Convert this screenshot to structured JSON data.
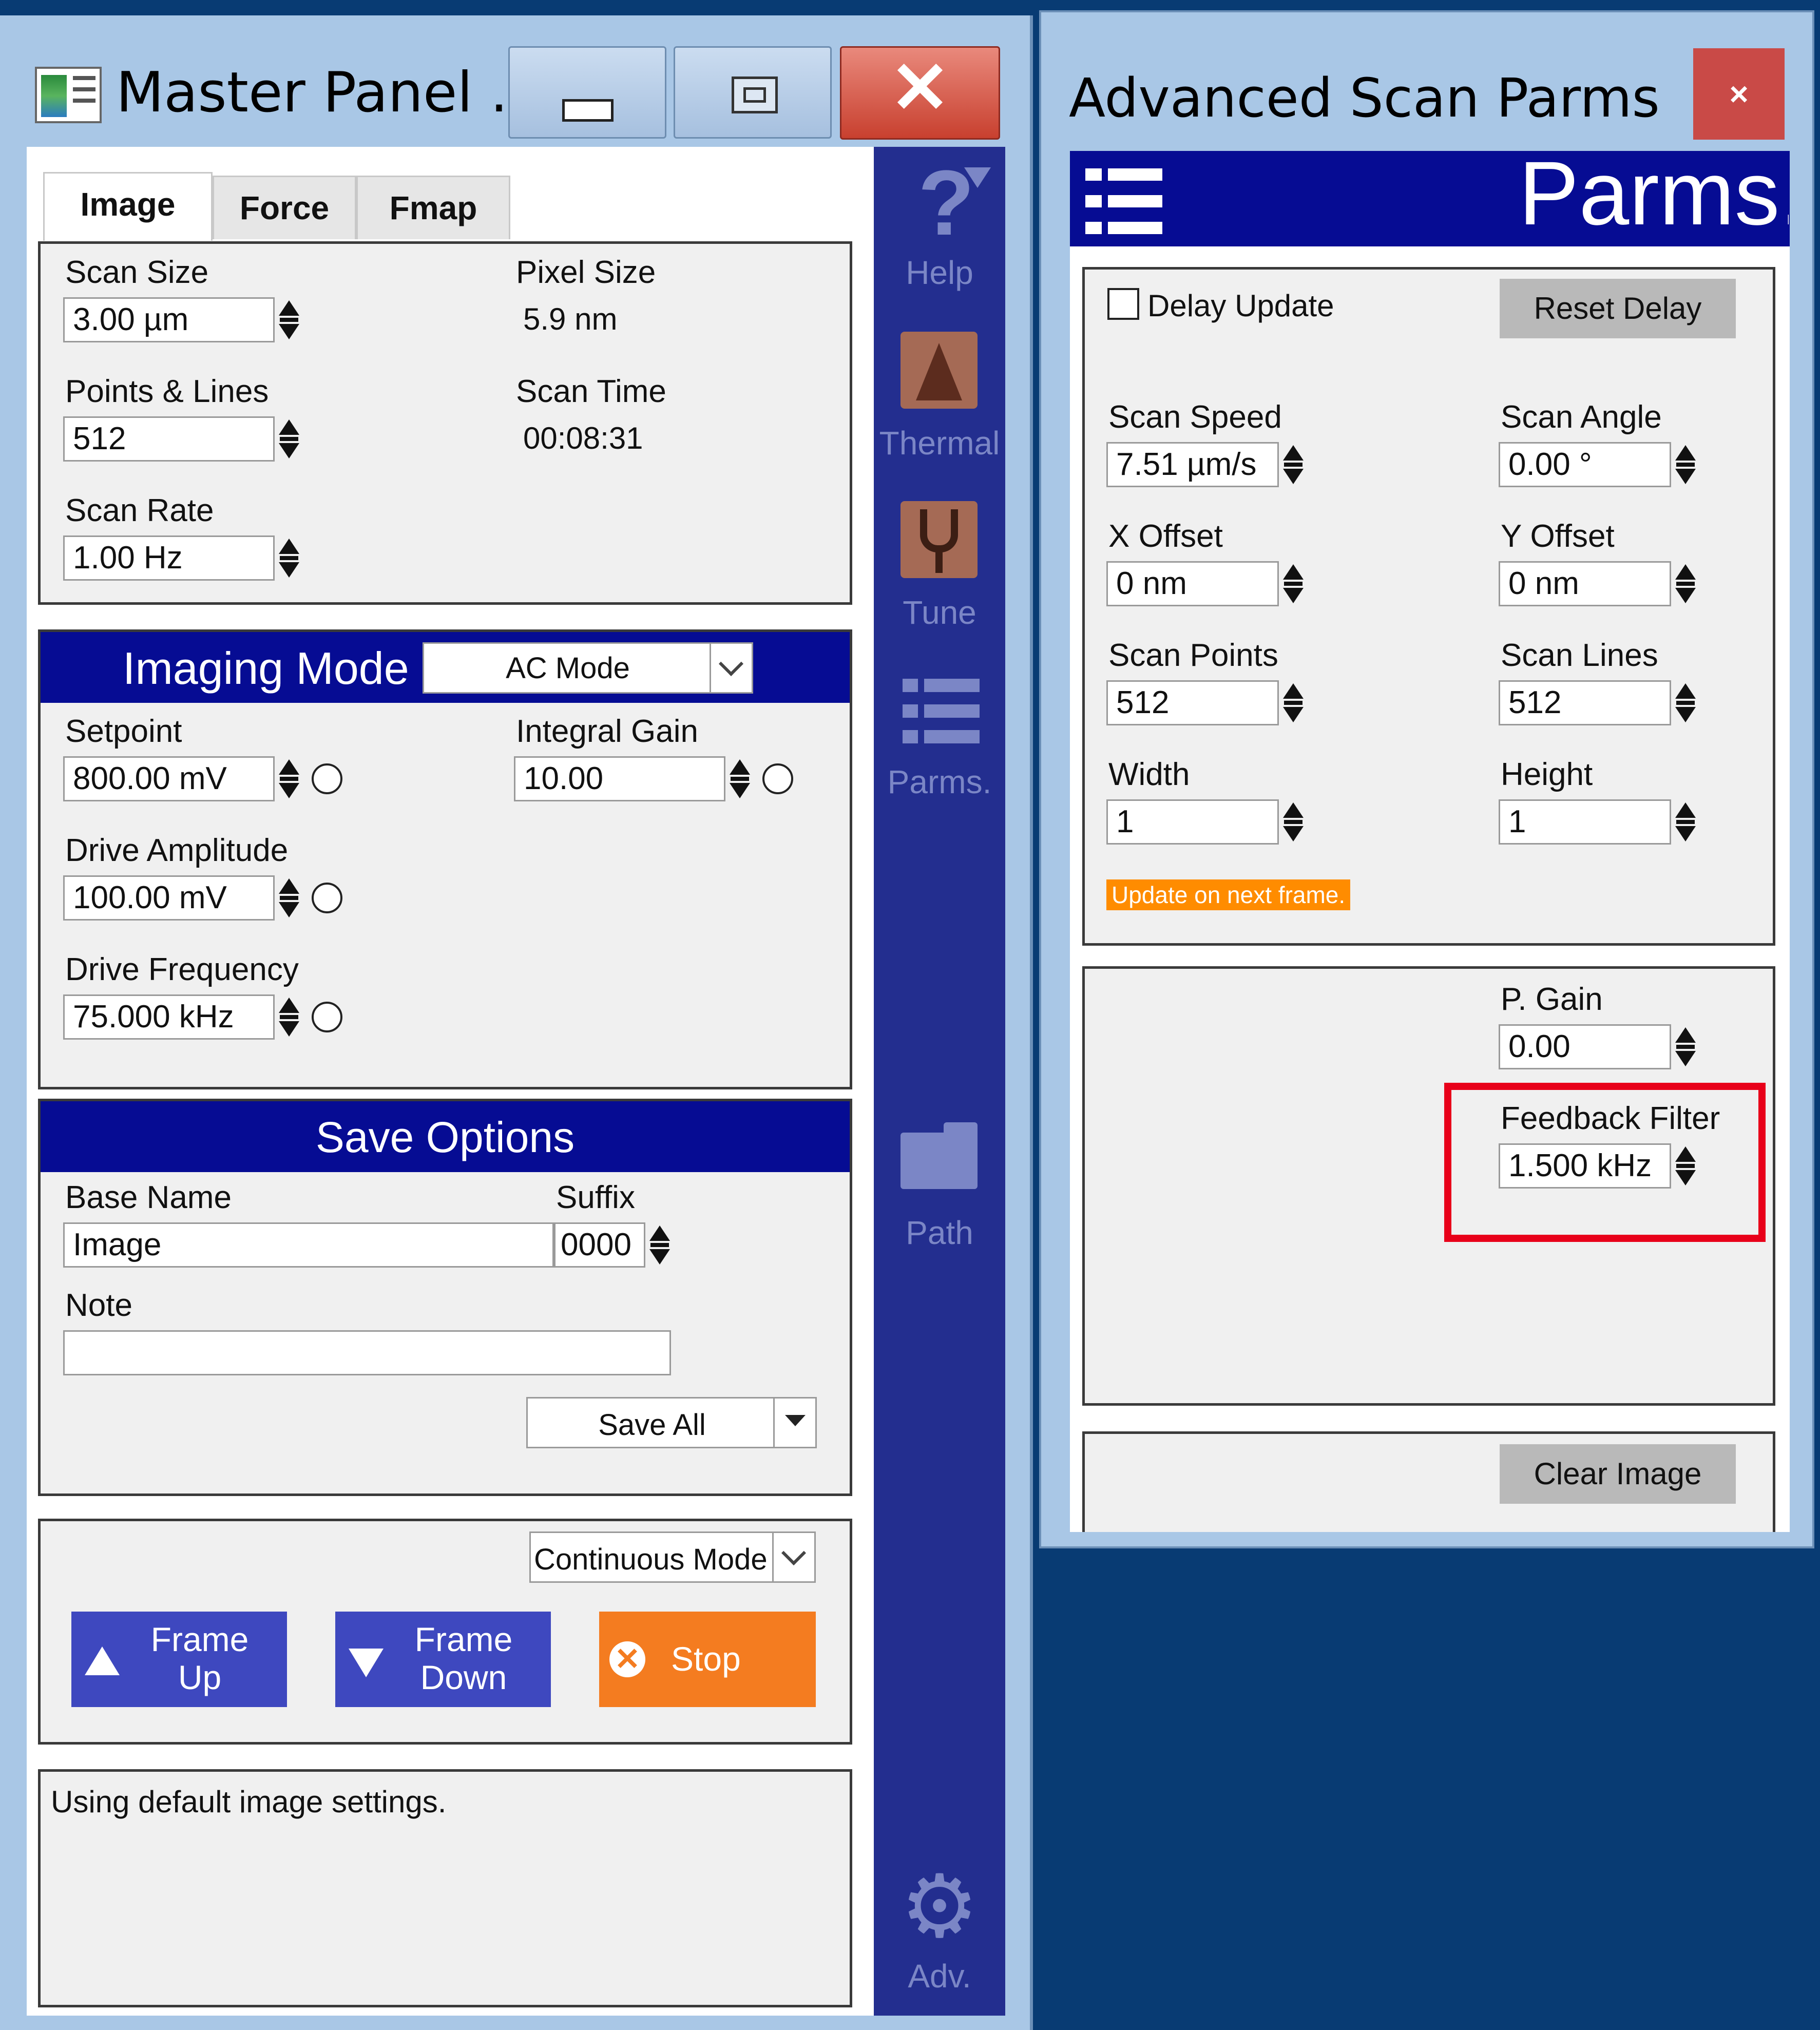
{
  "master_panel": {
    "title": "Master Panel ...",
    "tabs": [
      "Image",
      "Force",
      "Fmap"
    ],
    "scan": {
      "scan_size_label": "Scan Size",
      "scan_size_value": "3.00 µm",
      "pixel_size_label": "Pixel Size",
      "pixel_size_value": "5.9 nm",
      "points_lines_label": "Points & Lines",
      "points_lines_value": "512",
      "scan_time_label": "Scan Time",
      "scan_time_value": "00:08:31",
      "scan_rate_label": "Scan Rate",
      "scan_rate_value": "1.00 Hz"
    },
    "imaging_mode": {
      "title": "Imaging Mode",
      "mode": "AC Mode",
      "setpoint_label": "Setpoint",
      "setpoint_value": "800.00 mV",
      "integral_gain_label": "Integral Gain",
      "integral_gain_value": "10.00",
      "drive_amplitude_label": "Drive Amplitude",
      "drive_amplitude_value": "100.00 mV",
      "drive_frequency_label": "Drive Frequency",
      "drive_frequency_value": "75.000 kHz"
    },
    "save_options": {
      "title": "Save Options",
      "base_name_label": "Base Name",
      "base_name_value": "Image",
      "suffix_label": "Suffix",
      "suffix_value": "0000",
      "note_label": "Note",
      "note_value": "",
      "save_select": "Save All"
    },
    "controls": {
      "mode_select": "Continuous Mode",
      "frame_up_line1": "Frame",
      "frame_up_line2": "Up",
      "frame_down_line1": "Frame",
      "frame_down_line2": "Down",
      "stop": "Stop"
    },
    "status": "Using default image settings."
  },
  "sidebar": {
    "help": "Help",
    "thermal": "Thermal",
    "tune": "Tune",
    "parms": "Parms.",
    "path": "Path",
    "adv": "Adv."
  },
  "advanced": {
    "title": "Advanced Scan Parms",
    "close": "×",
    "header_text": "Parms.",
    "delay_update_label": "Delay Update",
    "reset_delay": "Reset Delay",
    "scan_speed_label": "Scan Speed",
    "scan_speed_value": "7.51 µm/s",
    "scan_angle_label": "Scan Angle",
    "scan_angle_value": "0.00 °",
    "x_offset_label": "X Offset",
    "x_offset_value": "0 nm",
    "y_offset_label": "Y Offset",
    "y_offset_value": "0 nm",
    "scan_points_label": "Scan Points",
    "scan_points_value": "512",
    "scan_lines_label": "Scan Lines",
    "scan_lines_value": "512",
    "width_label": "Width",
    "width_value": "1",
    "height_label": "Height",
    "height_value": "1",
    "update_notice": "Update on next frame.",
    "p_gain_label": "P. Gain",
    "p_gain_value": "0.00",
    "feedback_filter_label": "Feedback Filter",
    "feedback_filter_value": "1.500 kHz",
    "clear_image": "Clear Image"
  },
  "colors": {
    "highlight": "#e8001a",
    "accent_blue": "#060c93",
    "stop_orange": "#f47c20",
    "frame_blue": "#3e48bf",
    "notice_orange": "#ff8c00"
  }
}
